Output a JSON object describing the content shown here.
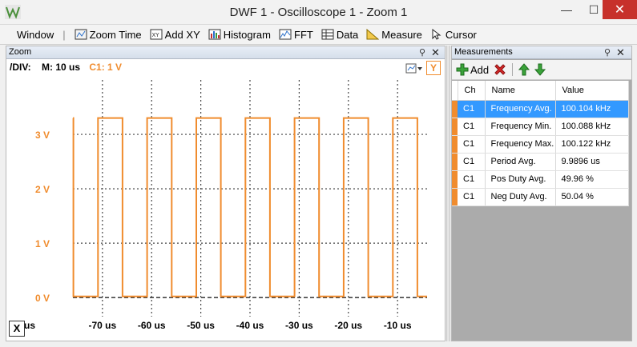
{
  "window": {
    "title": "DWF 1 - Oscilloscope 1 - Zoom 1",
    "min_glyph": "—",
    "max_glyph": "☐",
    "close_glyph": "✕"
  },
  "toolbar": {
    "window_label": "Window",
    "separator": "|",
    "items": [
      {
        "label": "Zoom Time",
        "icon": "zoom-time-icon"
      },
      {
        "label": "Add XY",
        "icon": "xy-icon"
      },
      {
        "label": "Histogram",
        "icon": "histogram-icon"
      },
      {
        "label": "FFT",
        "icon": "fft-icon"
      },
      {
        "label": "Data",
        "icon": "data-icon"
      },
      {
        "label": "Measure",
        "icon": "measure-icon"
      },
      {
        "label": "Cursor",
        "icon": "cursor-icon"
      }
    ]
  },
  "zoom_panel": {
    "title": "Zoom",
    "div_label": "/DIV:",
    "m_label": "M: 10 us",
    "c1_label": "C1: 1 V",
    "y_button": "Y",
    "x_button": "X"
  },
  "measurements_panel": {
    "title": "Measurements",
    "add_label": "Add",
    "columns": [
      "Ch",
      "Name",
      "Value"
    ],
    "rows": [
      {
        "ch": "C1",
        "name": "Frequency Avg.",
        "value": "100.104 kHz",
        "selected": true
      },
      {
        "ch": "C1",
        "name": "Frequency Min.",
        "value": "100.088 kHz"
      },
      {
        "ch": "C1",
        "name": "Frequency Max.",
        "value": "100.122 kHz"
      },
      {
        "ch": "C1",
        "name": "Period Avg.",
        "value": "9.9896 us"
      },
      {
        "ch": "C1",
        "name": "Pos Duty Avg.",
        "value": "49.96 %"
      },
      {
        "ch": "C1",
        "name": "Neg Duty Avg.",
        "value": "50.04 %"
      }
    ]
  },
  "colors": {
    "trace": "#f08c2e",
    "selection": "#3399ff"
  },
  "chart_data": {
    "type": "line",
    "series": [
      {
        "name": "C1",
        "color": "#f08c2e"
      }
    ],
    "y_ticks": [
      "3 V",
      "2 V",
      "1 V",
      "0 V"
    ],
    "y_tick_values": [
      3,
      2,
      1,
      0
    ],
    "x_ticks": [
      "-70 us",
      "-60 us",
      "-50 us",
      "-40 us",
      "-30 us",
      "-20 us",
      "-10 us"
    ],
    "x_tick_values": [
      -70,
      -60,
      -50,
      -40,
      -30,
      -20,
      -10
    ],
    "x_unit_label": "us",
    "xlim": [
      -76,
      -4
    ],
    "ylim": [
      -0.35,
      4.0
    ],
    "signal": {
      "low": 0.02,
      "high": 3.3,
      "period_us": 9.9896,
      "duty": 0.4996,
      "first_rise_us": -70.9
    },
    "grid": true
  }
}
